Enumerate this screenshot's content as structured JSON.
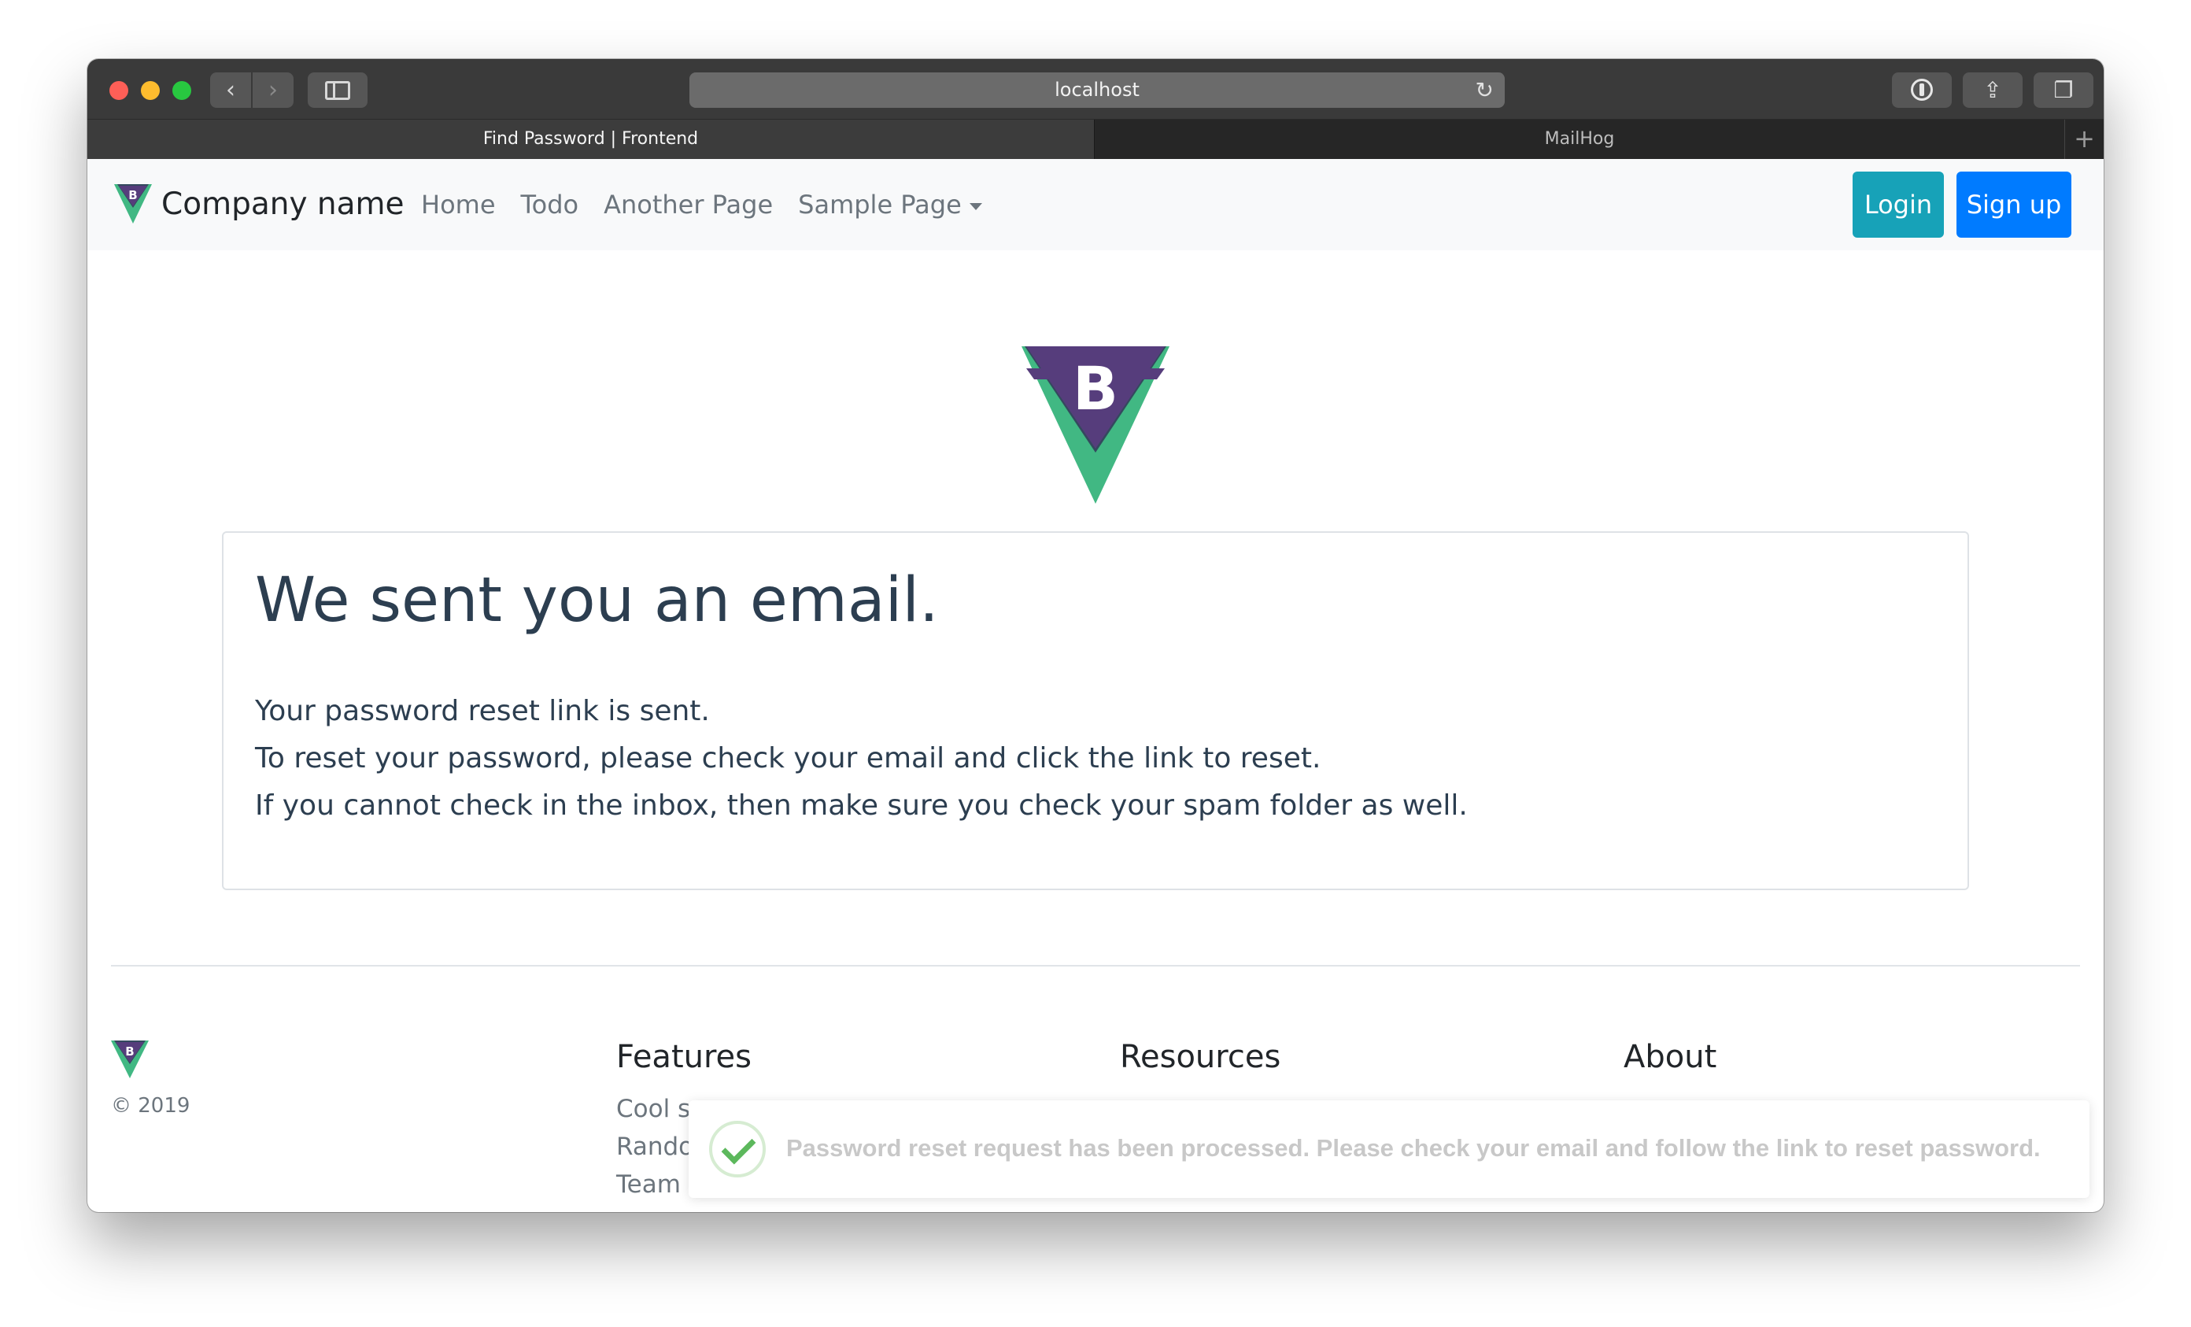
{
  "browser": {
    "address": "localhost",
    "tabs": [
      {
        "label": "Find Password | Frontend",
        "active": true
      },
      {
        "label": "MailHog",
        "active": false
      }
    ]
  },
  "navbar": {
    "brand": "Company name",
    "links": [
      "Home",
      "Todo",
      "Another Page",
      "Sample Page"
    ],
    "login_label": "Login",
    "signup_label": "Sign up"
  },
  "card": {
    "title": "We sent you an email.",
    "lines": [
      "Your password reset link is sent.",
      "To reset your password, please check your email and click the link to reset.",
      "If you cannot check in the inbox, then make sure you check your spam folder as well."
    ]
  },
  "footer": {
    "copyright": "© 2019",
    "features": {
      "heading": "Features",
      "items": [
        "Cool s",
        "Rando",
        "Team f"
      ]
    },
    "resources": {
      "heading": "Resources"
    },
    "about": {
      "heading": "About"
    }
  },
  "toast": {
    "message": "Password reset request has been processed. Please check your email and follow the link to reset password."
  },
  "colors": {
    "primary": "#007bff",
    "info": "#17a2b8",
    "logo_purple": "#563d7c",
    "logo_green": "#41b883",
    "logo_dark": "#34495e",
    "success": "#5cb85c"
  }
}
